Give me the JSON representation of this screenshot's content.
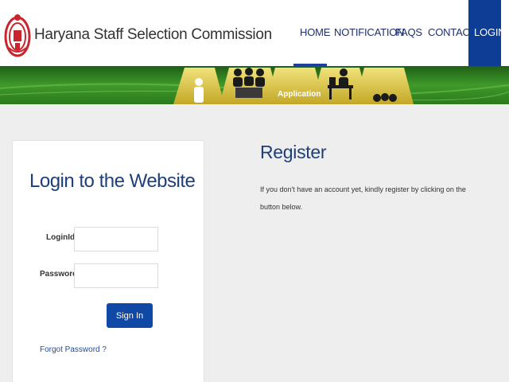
{
  "header": {
    "site_title": "Haryana Staff Selection Commission",
    "logo_icon": "haryana-emblem-icon",
    "nav": {
      "home": "HOME",
      "notification": "NOTIFICATION",
      "faqs": "FAQS",
      "contact": "CONTACT",
      "login": "LOGIN"
    }
  },
  "banner": {
    "label": "Application",
    "icons": [
      "person-icon",
      "group-meeting-icon",
      "application-icon",
      "desk-worker-icon",
      "team-icon"
    ]
  },
  "login": {
    "title": "Login to the Website",
    "loginid_label": "LoginId",
    "loginid_value": "",
    "password_label": "Password",
    "password_value": "",
    "signin_label": "Sign In",
    "forgot_label": "Forgot Password ?"
  },
  "register": {
    "title": "Register",
    "text": "If you don't have an account yet, kindly register by clicking on the button below."
  },
  "colors": {
    "brand_blue": "#0d3d95",
    "button_blue": "#1048a5",
    "heading_blue": "#1f3f78",
    "banner_green": "#2f7a1e",
    "banner_gold": "#d8c340",
    "emblem_red": "#c9252c"
  }
}
